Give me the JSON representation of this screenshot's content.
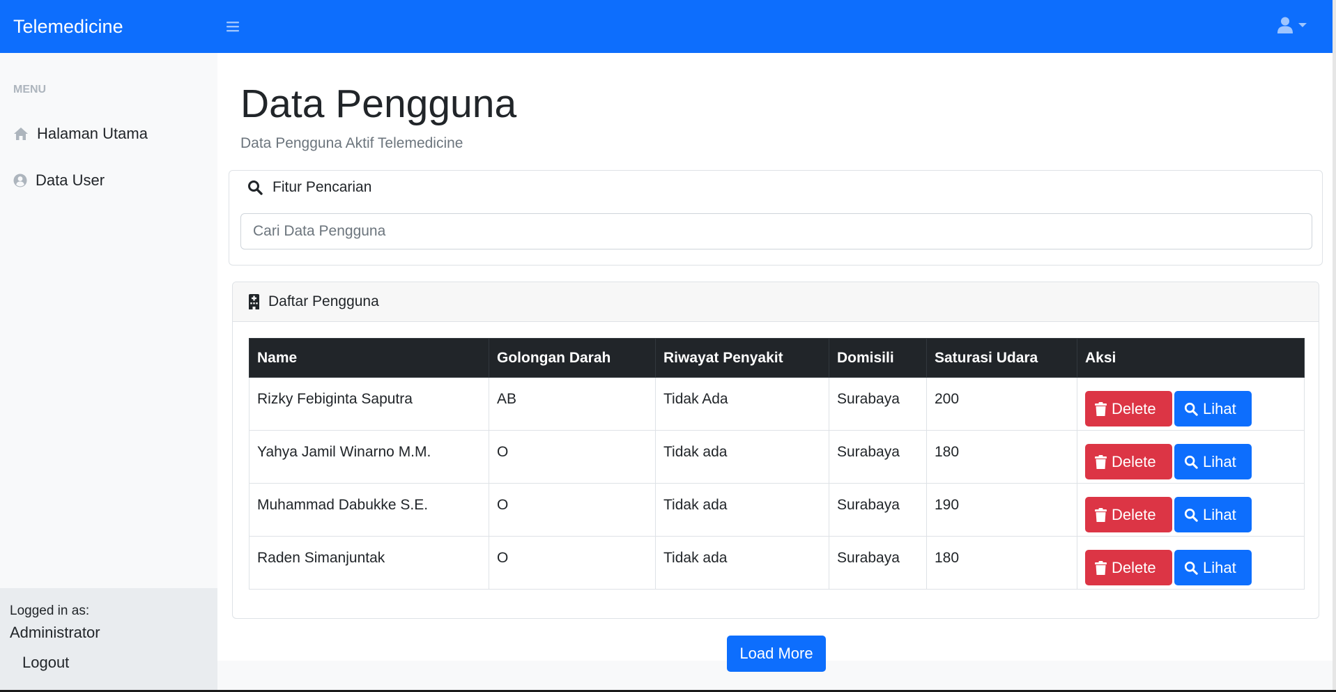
{
  "topbar": {
    "brand": "Telemedicine",
    "toggler_icon": "hamburger-icon",
    "user_icon": "user-icon",
    "caret_icon": "caret-down-icon",
    "color": "#0d6efd"
  },
  "sidebar": {
    "menu_heading": "MENU",
    "items": [
      {
        "label": "Halaman Utama",
        "icon": "home-icon"
      },
      {
        "label": "Data User",
        "icon": "user-circle-icon"
      }
    ],
    "footer": {
      "logged_in_label": "Logged in as:",
      "user_name": "Administrator",
      "logout_label": "Logout"
    }
  },
  "main": {
    "title": "Data Pengguna",
    "subtitle": "Data Pengguna Aktif Telemedicine",
    "search": {
      "heading": "Fitur Pencarian",
      "icon": "search-icon",
      "placeholder": "Cari Data Pengguna",
      "value": ""
    },
    "list": {
      "heading": "Daftar Pengguna",
      "icon": "hospital-icon",
      "columns": [
        "Name",
        "Golongan Darah",
        "Riwayat Penyakit",
        "Domisili",
        "Saturasi Udara",
        "Aksi"
      ],
      "rows": [
        {
          "name": "Rizky Febiginta Saputra",
          "golongan_darah": "AB",
          "riwayat_penyakit": "Tidak Ada",
          "domisili": "Surabaya",
          "saturasi_udara": "200"
        },
        {
          "name": "Yahya Jamil Winarno M.M.",
          "golongan_darah": "O",
          "riwayat_penyakit": "Tidak ada",
          "domisili": "Surabaya",
          "saturasi_udara": "180"
        },
        {
          "name": "Muhammad Dabukke S.E.",
          "golongan_darah": "O",
          "riwayat_penyakit": "Tidak ada",
          "domisili": "Surabaya",
          "saturasi_udara": "190"
        },
        {
          "name": "Raden Simanjuntak",
          "golongan_darah": "O",
          "riwayat_penyakit": "Tidak ada",
          "domisili": "Surabaya",
          "saturasi_udara": "180"
        }
      ],
      "delete_label": "Delete",
      "view_label": "Lihat",
      "delete_color": "#dc3545",
      "view_color": "#0d6efd"
    },
    "load_more_label": "Load More"
  }
}
